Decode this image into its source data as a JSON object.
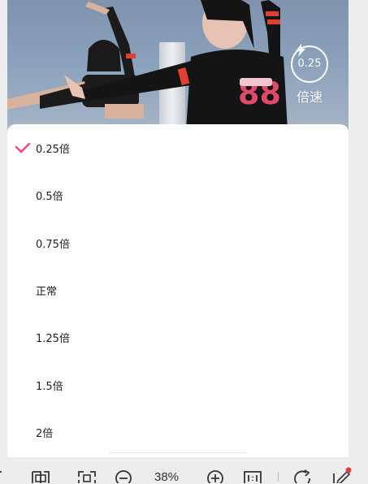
{
  "video": {
    "speed_value": "0.25",
    "speed_label": "倍速"
  },
  "speed_menu": {
    "selected_index": 0,
    "accent_color": "#ff3d7f",
    "options": [
      {
        "label": "0.25倍"
      },
      {
        "label": "0.5倍"
      },
      {
        "label": "0.75倍"
      },
      {
        "label": "正常"
      },
      {
        "label": "1.25倍"
      },
      {
        "label": "1.5倍"
      },
      {
        "label": "2倍"
      }
    ]
  },
  "toolbar": {
    "zoom": "38%",
    "icons": [
      "crop-icon",
      "fit-screen-icon",
      "zoom-out-icon",
      "zoom-in-icon",
      "actual-size-icon",
      "rotate-icon",
      "edit-icon"
    ],
    "notification_dot_color": "#e53935"
  }
}
